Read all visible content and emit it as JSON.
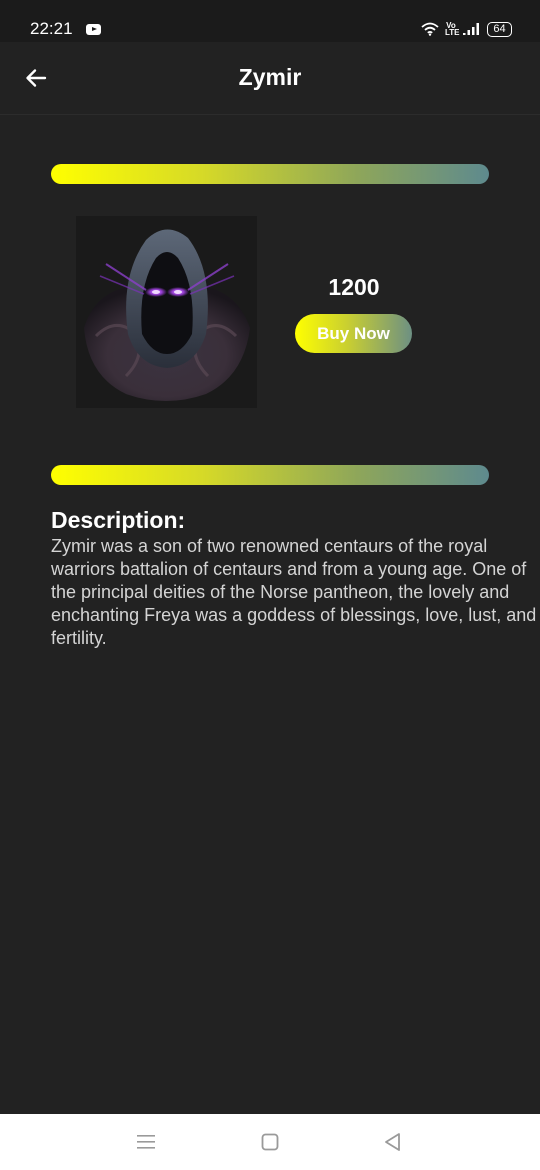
{
  "status_bar": {
    "time": "22:21",
    "volte_text": "Vo LTE",
    "battery": "64",
    "icons": [
      "media-icon",
      "wifi-icon",
      "volte-icon",
      "signal-icon",
      "battery-icon"
    ]
  },
  "app_bar": {
    "title": "Zymir",
    "back_icon": "arrow-left-icon"
  },
  "theme": {
    "background": "#222222",
    "gradient_start": "#ffff00",
    "gradient_end": "#5e8a8e",
    "text": "#ffffff"
  },
  "product": {
    "image_alt": "hooded figure with glowing purple eyes",
    "price": "1200",
    "buy_label": "Buy Now"
  },
  "description": {
    "heading": "Description:",
    "text": "Zymir was a son of two renowned centaurs of the royal warriors battalion of centaurs and from a young age. One of the principal deities of the Norse pantheon, the lovely and enchanting Freya was a goddess of blessings, love, lust, and fertility."
  },
  "nav_bar": {
    "icons": [
      "menu-icon",
      "home-icon",
      "back-triangle-icon"
    ]
  }
}
